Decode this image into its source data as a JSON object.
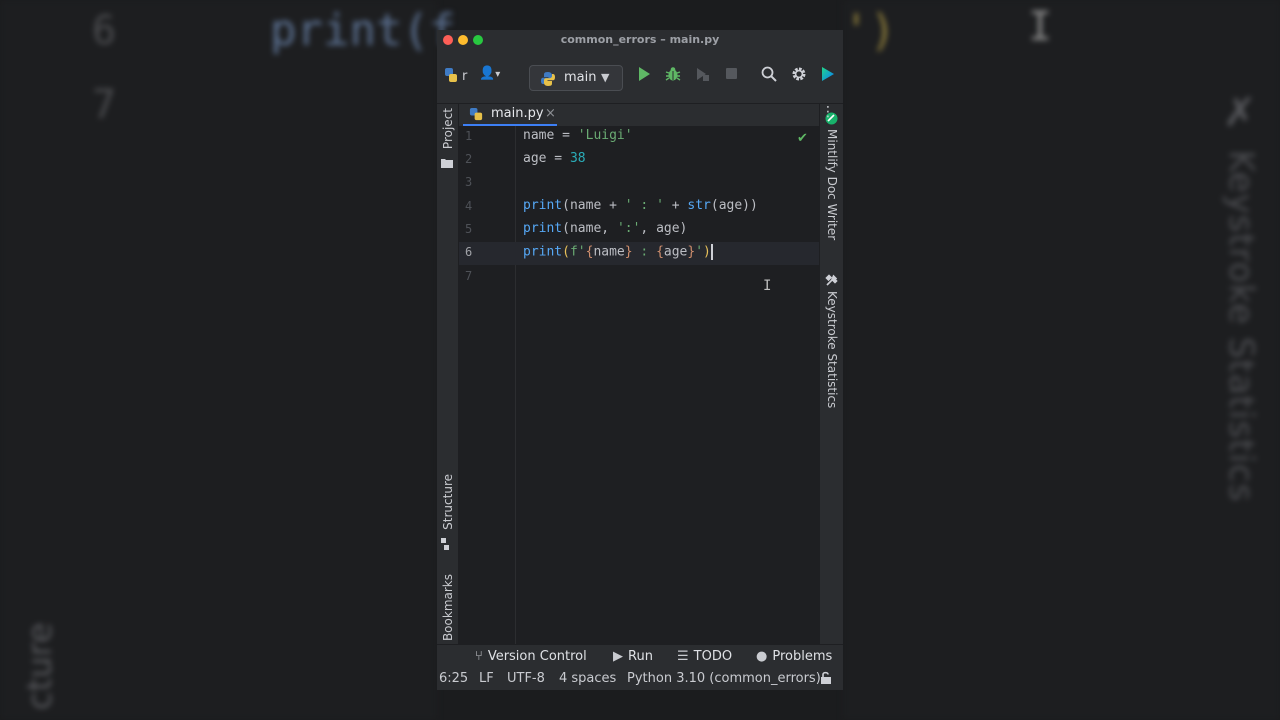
{
  "window": {
    "title": "common_errors – main.py"
  },
  "toolbar": {
    "project_initial": "r",
    "branch_label": "main"
  },
  "left_strip": {
    "project": "Project",
    "structure": "Structure",
    "bookmarks": "Bookmarks"
  },
  "right_strip": {
    "mintlify": "Mintlify Doc Writer",
    "keystroke": "Keystroke Statistics"
  },
  "tabs": [
    {
      "label": "main.py",
      "close": "×"
    }
  ],
  "editor": {
    "line_numbers": [
      "1",
      "2",
      "3",
      "4",
      "5",
      "6",
      "7"
    ],
    "current_line": 6,
    "lines": {
      "l1": {
        "a": "name = ",
        "b": "'Luigi'"
      },
      "l2": {
        "a": "age = ",
        "b": "38"
      },
      "l4": {
        "fn": "print",
        "a": "(name + ",
        "s1": "' : '",
        "b": " + ",
        "bi": "str",
        "c": "(age))"
      },
      "l5": {
        "fn": "print",
        "a": "(name, ",
        "s1": "':'",
        "b": ", age)"
      },
      "l6": {
        "fn": "print",
        "p1": "(",
        "f": "f'",
        "b1": "{",
        "v1": "name",
        "b2": "}",
        "mid": " : ",
        "b3": "{",
        "v2": "age",
        "b4": "}",
        "q": "'",
        "p2": ")"
      }
    }
  },
  "bottom_tools": {
    "version_control": "Version Control",
    "run": "Run",
    "todo": "TODO",
    "problems": "Problems"
  },
  "status": {
    "position": "6:25",
    "line_sep": "LF",
    "encoding": "UTF-8",
    "indent": "4 spaces",
    "interpreter": "Python 3.10 (common_errors)"
  },
  "background": {
    "line_six": "6",
    "line_seven": "7",
    "code_frag": "print(f",
    "paren_frag": "')",
    "structure_frag": "cture",
    "keystroke_frag": "Keystroke Statistics"
  },
  "colors": {
    "accent": "#3d7ff5",
    "run_green": "#5fb865",
    "editor_bg": "#1e1f22",
    "panel_bg": "#2b2d30"
  }
}
